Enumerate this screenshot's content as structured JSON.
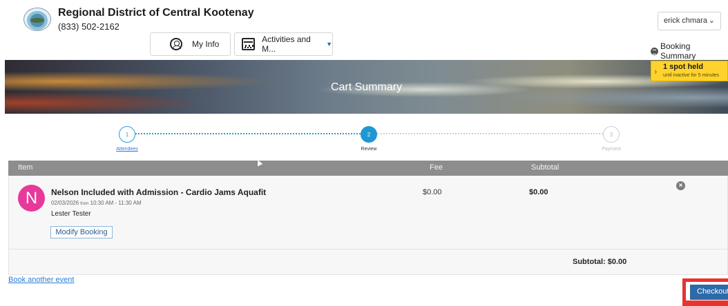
{
  "org": {
    "name": "Regional District of Central Kootenay",
    "phone": "(833) 502-2162"
  },
  "user_menu": {
    "selected": "erick chmara"
  },
  "nav": {
    "my_info": "My Info",
    "activities": "Activities and M..."
  },
  "booking_summary_label": "Booking Summary",
  "banner": {
    "title": "Cart Summary"
  },
  "hold_notice": {
    "title": "1 spot held",
    "subtitle": "until inactive for 5 minutes"
  },
  "stepper": {
    "steps": [
      {
        "number": "1",
        "label": "Attendees",
        "state": "done"
      },
      {
        "number": "2",
        "label": "Review",
        "state": "current"
      },
      {
        "number": "3",
        "label": "Payment",
        "state": "pending"
      }
    ]
  },
  "table": {
    "headers": {
      "item": "Item",
      "fee": "Fee",
      "subtotal": "Subtotal"
    },
    "rows": [
      {
        "avatar_letter": "N",
        "avatar_color": "#e6399b",
        "title": "Nelson Included with Admission - Cardio Jams Aquafit",
        "date": "02/03/2026",
        "from_label": "from",
        "time": "10:30 AM - 11:30 AM",
        "attendee": "Lester Tester",
        "modify_label": "Modify Booking",
        "fee": "$0.00",
        "subtotal": "$0.00"
      }
    ],
    "total": "Subtotal: $0.00"
  },
  "actions": {
    "book_another": "Book another event",
    "checkout": "Checkout"
  },
  "colors": {
    "accent": "#1f97d4",
    "checkout": "#2c6aa8",
    "highlight": "#e8332f",
    "hold_badge": "#ffd22e"
  }
}
